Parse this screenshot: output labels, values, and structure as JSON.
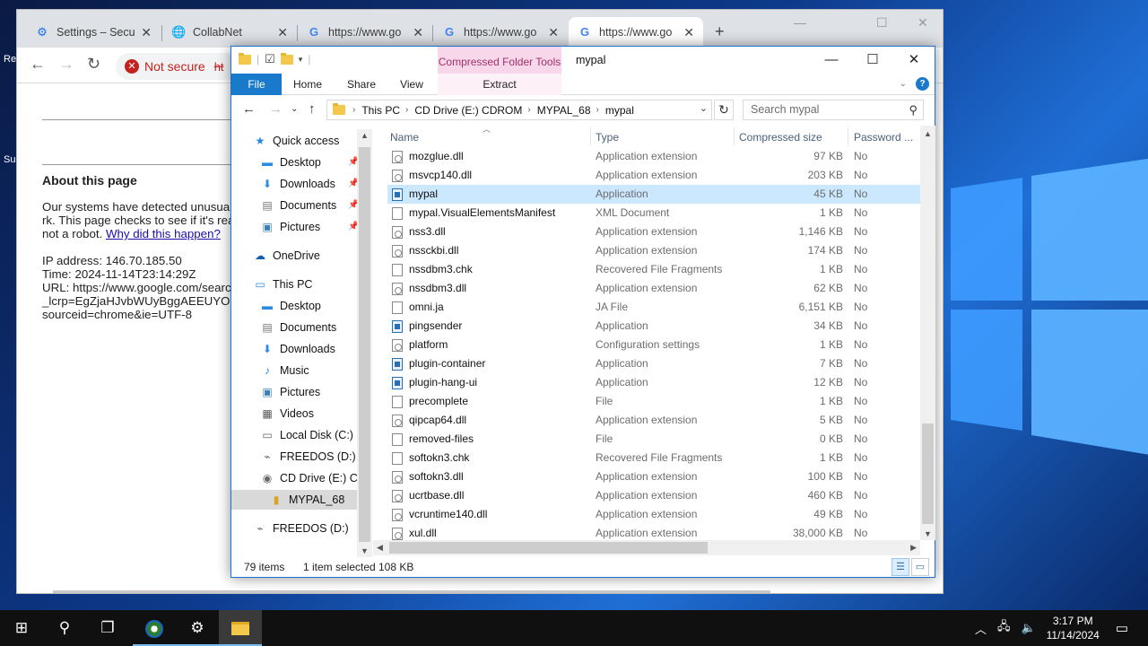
{
  "desktop": {
    "frag1": "Re",
    "frag2": "Su"
  },
  "chrome": {
    "tabs": [
      {
        "label": "Settings – Secu",
        "icon": "gear-icon"
      },
      {
        "label": "CollabNet",
        "icon": "globe-icon"
      },
      {
        "label": "https://www.go",
        "icon": "google-icon"
      },
      {
        "label": "https://www.go",
        "icon": "google-icon"
      },
      {
        "label": "https://www.go",
        "icon": "google-icon"
      }
    ],
    "new_tab": "+",
    "not_secure": "Not secure",
    "url_frag": "ht",
    "page": {
      "about_title": "About this page",
      "lines": [
        "Our systems have detected unusual",
        "rk. This page checks to see if it's real",
        "not a robot."
      ],
      "why_link": "Why did this happen?",
      "ip": "IP address: 146.70.185.50",
      "time": "Time: 2024-11-14T23:14:29Z",
      "url1": "URL: https://www.google.com/search",
      "url2": "_lcrp=EgZjaHJvbWUyBggAEEUYOd",
      "url3": "sourceid=chrome&ie=UTF-8"
    }
  },
  "explorer": {
    "title": "mypal",
    "context_tab": "Compressed Folder Tools",
    "ribbon_tabs": [
      "File",
      "Home",
      "Share",
      "View",
      "Extract"
    ],
    "address": [
      "This PC",
      "CD Drive (E:) CDROM",
      "MYPAL_68",
      "mypal"
    ],
    "search_placeholder": "Search mypal",
    "columns": [
      "Name",
      "Type",
      "Compressed size",
      "Password ..."
    ],
    "nav": [
      {
        "label": "Quick access",
        "icon": "star-icon"
      },
      {
        "label": "Desktop",
        "icon": "desktop-icon"
      },
      {
        "label": "Downloads",
        "icon": "download-icon"
      },
      {
        "label": "Documents",
        "icon": "documents-icon"
      },
      {
        "label": "Pictures",
        "icon": "pictures-icon"
      },
      {
        "label": "OneDrive",
        "icon": "cloud-icon"
      },
      {
        "label": "This PC",
        "icon": "computer-icon"
      },
      {
        "label": "Desktop",
        "icon": "desktop-icon"
      },
      {
        "label": "Documents",
        "icon": "documents-icon"
      },
      {
        "label": "Downloads",
        "icon": "download-icon"
      },
      {
        "label": "Music",
        "icon": "music-icon"
      },
      {
        "label": "Pictures",
        "icon": "pictures-icon"
      },
      {
        "label": "Videos",
        "icon": "videos-icon"
      },
      {
        "label": "Local Disk (C:)",
        "icon": "drive-icon"
      },
      {
        "label": "FREEDOS (D:)",
        "icon": "usb-drive-icon"
      },
      {
        "label": "CD Drive (E:) CD",
        "icon": "cd-drive-icon"
      },
      {
        "label": "MYPAL_68",
        "icon": "zip-folder-icon"
      },
      {
        "label": "FREEDOS (D:)",
        "icon": "usb-drive-icon"
      }
    ],
    "files": [
      {
        "name": "mozglue.dll",
        "type": "Application extension",
        "size": "97 KB",
        "pw": "No",
        "kind": "dll"
      },
      {
        "name": "msvcp140.dll",
        "type": "Application extension",
        "size": "203 KB",
        "pw": "No",
        "kind": "dll"
      },
      {
        "name": "mypal",
        "type": "Application",
        "size": "45 KB",
        "pw": "No",
        "kind": "app"
      },
      {
        "name": "mypal.VisualElementsManifest",
        "type": "XML Document",
        "size": "1 KB",
        "pw": "No",
        "kind": "doc"
      },
      {
        "name": "nss3.dll",
        "type": "Application extension",
        "size": "1,146 KB",
        "pw": "No",
        "kind": "dll"
      },
      {
        "name": "nssckbi.dll",
        "type": "Application extension",
        "size": "174 KB",
        "pw": "No",
        "kind": "dll"
      },
      {
        "name": "nssdbm3.chk",
        "type": "Recovered File Fragments",
        "size": "1 KB",
        "pw": "No",
        "kind": "doc"
      },
      {
        "name": "nssdbm3.dll",
        "type": "Application extension",
        "size": "62 KB",
        "pw": "No",
        "kind": "dll"
      },
      {
        "name": "omni.ja",
        "type": "JA File",
        "size": "6,151 KB",
        "pw": "No",
        "kind": "doc"
      },
      {
        "name": "pingsender",
        "type": "Application",
        "size": "34 KB",
        "pw": "No",
        "kind": "app"
      },
      {
        "name": "platform",
        "type": "Configuration settings",
        "size": "1 KB",
        "pw": "No",
        "kind": "dll"
      },
      {
        "name": "plugin-container",
        "type": "Application",
        "size": "7 KB",
        "pw": "No",
        "kind": "app"
      },
      {
        "name": "plugin-hang-ui",
        "type": "Application",
        "size": "12 KB",
        "pw": "No",
        "kind": "app"
      },
      {
        "name": "precomplete",
        "type": "File",
        "size": "1 KB",
        "pw": "No",
        "kind": "doc"
      },
      {
        "name": "qipcap64.dll",
        "type": "Application extension",
        "size": "5 KB",
        "pw": "No",
        "kind": "dll"
      },
      {
        "name": "removed-files",
        "type": "File",
        "size": "0 KB",
        "pw": "No",
        "kind": "doc"
      },
      {
        "name": "softokn3.chk",
        "type": "Recovered File Fragments",
        "size": "1 KB",
        "pw": "No",
        "kind": "doc"
      },
      {
        "name": "softokn3.dll",
        "type": "Application extension",
        "size": "100 KB",
        "pw": "No",
        "kind": "dll"
      },
      {
        "name": "ucrtbase.dll",
        "type": "Application extension",
        "size": "460 KB",
        "pw": "No",
        "kind": "dll"
      },
      {
        "name": "vcruntime140.dll",
        "type": "Application extension",
        "size": "49 KB",
        "pw": "No",
        "kind": "dll"
      },
      {
        "name": "xul.dll",
        "type": "Application extension",
        "size": "38,000 KB",
        "pw": "No",
        "kind": "dll"
      }
    ],
    "selected_file": "mypal",
    "status": {
      "count": "79 items",
      "selected": "1 item selected",
      "size": "108 KB"
    }
  },
  "taskbar": {
    "time": "3:17 PM",
    "date": "11/14/2024",
    "apps": [
      "start-icon",
      "search-icon",
      "task-view-icon",
      "browser-icon",
      "settings-icon",
      "file-explorer-icon"
    ]
  }
}
